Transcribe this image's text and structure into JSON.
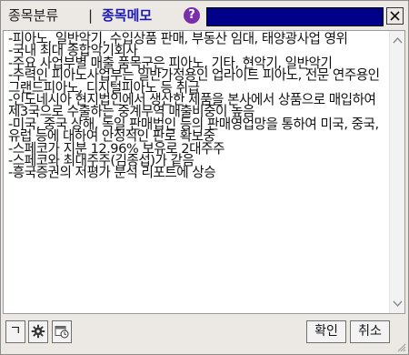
{
  "titlebar": {
    "tab_classify": "종목분류",
    "separator": "|",
    "tab_memo": "종목메모",
    "help_glyph": "?",
    "title_value": ""
  },
  "icons": {
    "help": "help-icon",
    "close": "close-icon",
    "scroll_up": "chevron-up-icon",
    "scroll_down": "chevron-down-icon",
    "gear": "gear-icon",
    "calendar": "calendar-clock-icon",
    "resize": "resize-grip-icon"
  },
  "memo": {
    "lines": [
      "-피아노, 일반악기, 수입상품 판매, 부동산 임대, 태양광사업 영위",
      "-국내 최대 종합악기회사",
      "-주요 사업부별 매출 품목군은 피아노, 기타, 현악기, 일반악기",
      "-주력인 피아노사업부는 일반가정용인 업라이트 피아노, 전문 연주용인 그랜드피아노, 디지털피아노 등 취급",
      "-인도네시아 현지법인에서 생산한 제품을 본사에서 상품으로 매입하여 제3국으로 수출하는 중계무역 매출비중이 높음",
      "-미국, 중국 상해, 독일 판매법인 등의 판매영업망을 통하여 미국, 중국, 유럽 등에 대하여 안정적인 판로 확보중",
      "-스페코가 지분 12.96% 보유로 2대주주",
      "-스페코와 최대주주(김종섭)가 같음",
      "-흥국증권의 저평가 분석 리포트에 상승"
    ]
  },
  "toolbar": {
    "giyeok_label": "ㄱ",
    "ok_label": "확인",
    "cancel_label": "취소"
  },
  "colors": {
    "tab_memo": "#1a1ab0",
    "help_bg": "#7a2ea8",
    "title_field_bg": "#000088",
    "window_bg": "#ece9e4"
  }
}
